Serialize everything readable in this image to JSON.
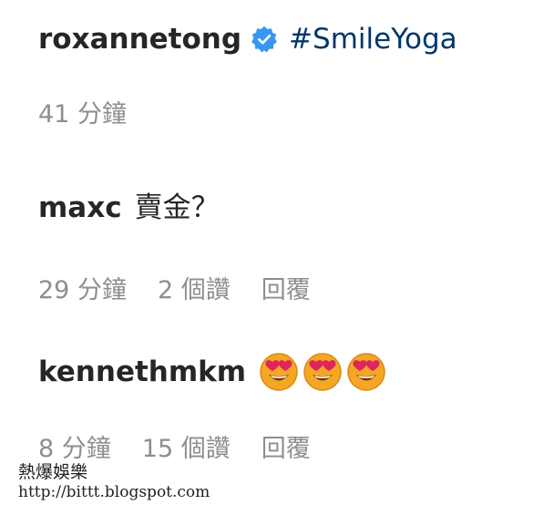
{
  "accent_color": "#3897f0",
  "comments": [
    {
      "username": "roxannetong",
      "verified": true,
      "hashtag": "#SmileYoga",
      "time": "41 分鐘"
    },
    {
      "username": "maxc",
      "text": "賣金？",
      "time": "29 分鐘",
      "likes": "2 個讚",
      "reply": "回覆"
    },
    {
      "username": "kennethmkm",
      "emojis": [
        "heart-eyes-emoji",
        "heart-eyes-emoji",
        "heart-eyes-emoji"
      ],
      "time": "8 分鐘",
      "likes": "15 個讚",
      "reply": "回覆"
    }
  ],
  "watermark": {
    "title": "熱爆娛樂",
    "url": "http://bittt.blogspot.com"
  }
}
